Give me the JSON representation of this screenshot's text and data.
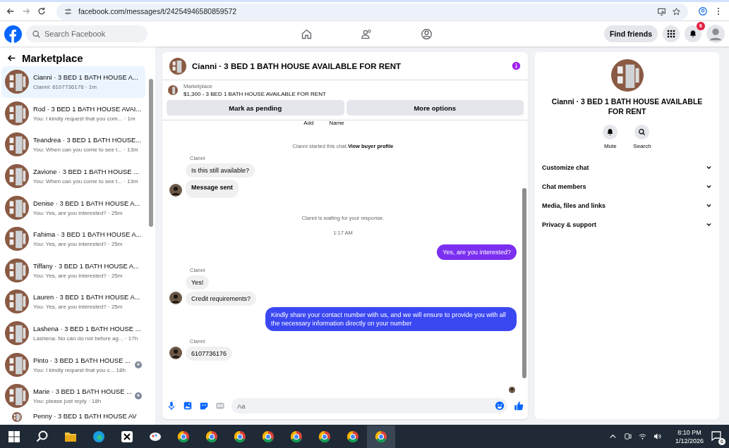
{
  "browser": {
    "url": "facebook.com/messages/t/24254946580859572"
  },
  "header": {
    "search_placeholder": "Search Facebook",
    "find_friends": "Find friends",
    "notification_count": "6"
  },
  "sidebar": {
    "title": "Marketplace",
    "conversations": [
      {
        "title": "Cianni · 3 BED 1 BATH HOUSE A...",
        "preview": "Cianni: 6107736176 · 1m",
        "selected": true,
        "seen": false
      },
      {
        "title": "Rod · 3 BED 1 BATH HOUSE AVAI...",
        "preview": "You: I kindly request that you com... · 1m",
        "selected": false,
        "seen": false
      },
      {
        "title": "Teandrea · 3 BED 1 BATH HOUSE...",
        "preview": "You: When can you come to see t... · 13m",
        "selected": false,
        "seen": false
      },
      {
        "title": "Zavione · 3 BED 1 BATH HOUSE ...",
        "preview": "You: When can you come to see t... · 13m",
        "selected": false,
        "seen": false
      },
      {
        "title": "Denise · 3 BED 1 BATH HOUSE A...",
        "preview": "You: Yes, are you interested? · 25m",
        "selected": false,
        "seen": false
      },
      {
        "title": "Fahima · 3 BED 1 BATH HOUSE A...",
        "preview": "You: Yes, are you interested? · 25m",
        "selected": false,
        "seen": false
      },
      {
        "title": "Tiffany · 3 BED 1 BATH HOUSE A...",
        "preview": "You: Yes, are you interested? · 25m",
        "selected": false,
        "seen": false
      },
      {
        "title": "Lauren · 3 BED 1 BATH HOUSE A...",
        "preview": "You: Yes, are you interested? · 25m",
        "selected": false,
        "seen": false
      },
      {
        "title": "Lashena · 3 BED 1 BATH HOUSE ...",
        "preview": "Lashena: No can do not before ag... · 17h",
        "selected": false,
        "seen": false
      },
      {
        "title": "Pinto · 3 BED 1 BATH HOUSE ...",
        "preview": "You: I kindly request that you c... 18h",
        "selected": false,
        "seen": true
      },
      {
        "title": "Marie · 3 BED 1 BATH HOUSE ...",
        "preview": "You: please just reply · 18h",
        "selected": false,
        "seen": true
      },
      {
        "title": "Penny · 3 BED 1 BATH HOUSE AV",
        "selected": false,
        "seen": false
      }
    ]
  },
  "chat": {
    "title": "Cianni · 3 BED 1 BATH HOUSE AVAILABLE FOR RENT",
    "listing": {
      "label": "Marketplace",
      "text": "$1,300 - 3 BED 1 BATH HOUSE AVAILABLE FOR RENT"
    },
    "buttons": [
      "Mark as pending",
      "More options"
    ],
    "top_fragments": [
      "Add",
      "Name"
    ],
    "messages": [
      {
        "kind": "system",
        "text": "Cianni started this chat.",
        "link": "View buyer profile"
      },
      {
        "kind": "incoming",
        "sender": "Cianni",
        "bubbles": [
          {
            "text": "Is this still available?",
            "bold": false
          },
          {
            "text": "Message sent",
            "bold": true
          }
        ]
      },
      {
        "kind": "system",
        "text": "Cianni is waiting for your response."
      },
      {
        "kind": "time",
        "text": "1:17 AM"
      },
      {
        "kind": "outgoing",
        "text": "Yes, are you interested?",
        "color": "#7b2ff0"
      },
      {
        "kind": "incoming",
        "sender": "Cianni",
        "bubbles": [
          {
            "text": "Yes!",
            "bold": false
          },
          {
            "text": "Credit requirements?",
            "bold": false
          }
        ]
      },
      {
        "kind": "outgoing",
        "text": "Kindly share your contact number with us, and we will ensure to provide you with all the necessary information directly on your number",
        "color": "#3b48f2"
      },
      {
        "kind": "incoming",
        "sender": "Cianni",
        "bubbles": [
          {
            "text": "6107736176",
            "bold": false
          }
        ]
      }
    ],
    "composer_placeholder": "Aa"
  },
  "details": {
    "title": "Cianni · 3 BED 1 BATH HOUSE AVAILABLE FOR RENT",
    "actions": [
      {
        "kind": "mute",
        "label": "Mute"
      },
      {
        "kind": "search",
        "label": "Search"
      }
    ],
    "sections": [
      "Customize chat",
      "Chat members",
      "Media, files and links",
      "Privacy & support"
    ]
  },
  "taskbar": {
    "time": "8:10 PM",
    "date": "1/12/2026",
    "notifications": "6"
  }
}
